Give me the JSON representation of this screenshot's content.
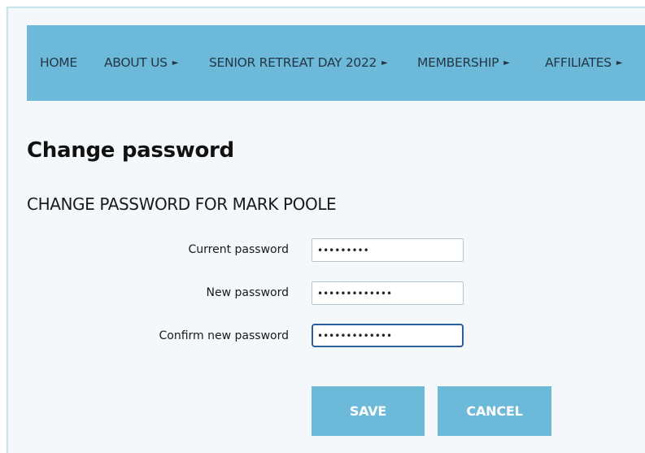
{
  "nav": {
    "items": [
      {
        "label": "HOME",
        "has_submenu": false
      },
      {
        "label": "ABOUT US",
        "has_submenu": true
      },
      {
        "label": "SENIOR RETREAT DAY 2022",
        "has_submenu": true
      },
      {
        "label": "MEMBERSHIP",
        "has_submenu": true
      },
      {
        "label": "AFFILIATES",
        "has_submenu": true
      }
    ],
    "submenu_arrow": "►"
  },
  "page": {
    "title": "Change password",
    "subtitle": "CHANGE PASSWORD FOR MARK POOLE"
  },
  "form": {
    "current_password": {
      "label": "Current password",
      "value": "•••••••••"
    },
    "new_password": {
      "label": "New password",
      "value": "•••••••••••••"
    },
    "confirm_password": {
      "label": "Confirm new password",
      "value": "•••••••••••••"
    }
  },
  "actions": {
    "save_label": "SAVE",
    "cancel_label": "CANCEL"
  },
  "colors": {
    "nav_background": "#6db9d9",
    "nav_text": "#243746",
    "button_background": "#6db9d9",
    "button_text": "#ffffff",
    "page_background": "#f4f8fa",
    "focus_border": "#2a5f9e"
  }
}
